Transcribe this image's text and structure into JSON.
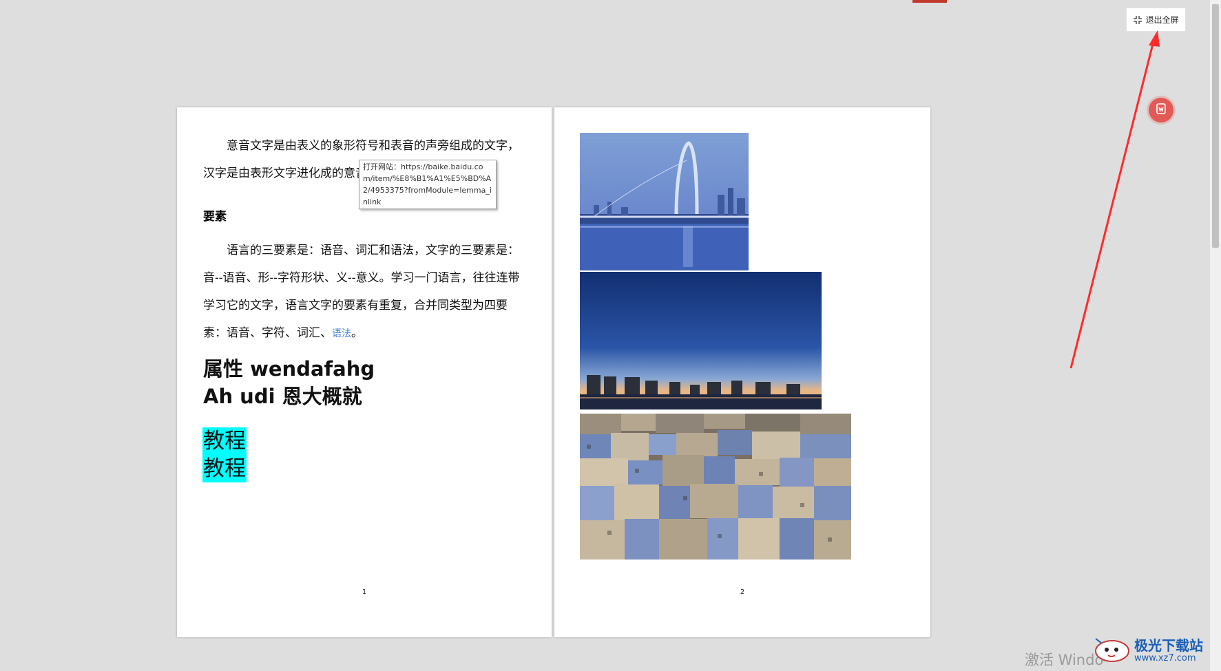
{
  "toolbar": {
    "exit_fullscreen_label": "退出全屏",
    "exit_fullscreen_icon": "exit-fullscreen-icon"
  },
  "floating_badge": {
    "icon": "doc-convert-icon",
    "color": "#e25a55"
  },
  "annotation": {
    "color": "#ff2a2a"
  },
  "pages": [
    {
      "paragraph_1": "意音文字是由表义的象形符号和表音的声旁组成的文字，汉字是由表形文字进化成的意音文字。",
      "tooltip": "打开网站：https://baike.baidu.com/item/%E8%B1%A1%E5%BD%A2/4953375?fromModule=lemma_inlink",
      "heading": "要素",
      "paragraph_2": "语言的三要素是：语音、词汇和语法，文字的三要素是：音--语音、形--字符形状、义--意义。学习一门语言，往往连带学习它的文字，语言文字的要素有重复，合并同类型为四要素：语音、字符、词汇、",
      "paragraph_2_link": "语法",
      "paragraph_2_end": "。",
      "big_heading_line1": "属性 wendafahg",
      "big_heading_line2": "Ah udi 恩大概就",
      "highlight_line1": "教程",
      "highlight_line2": "教程",
      "highlight_color": "#00ffff",
      "page_number": "1"
    },
    {
      "images": [
        "bridge-night-photo",
        "city-skyline-dusk-photo",
        "dense-old-town-photo"
      ],
      "page_number": "2"
    }
  ],
  "watermark": {
    "activate_text": "激活 Windo",
    "site_name": "极光下载站",
    "site_url": "www.xz7.com"
  }
}
